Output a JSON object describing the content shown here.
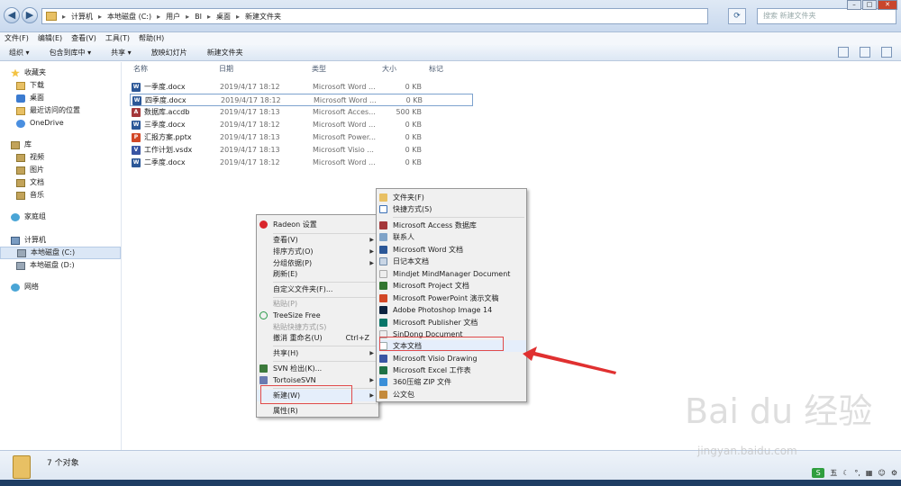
{
  "address": {
    "crumbs": [
      "计算机",
      "本地磁盘 (C:)",
      "用户",
      "BI",
      "桌面",
      "新建文件夹"
    ],
    "search_placeholder": "搜索 新建文件夹"
  },
  "menubar": [
    "文件(F)",
    "编辑(E)",
    "查看(V)",
    "工具(T)",
    "帮助(H)"
  ],
  "toolbar": [
    "组织 ▾",
    "包含到库中 ▾",
    "共享 ▾",
    "放映幻灯片",
    "新建文件夹"
  ],
  "sidebar": {
    "favorites": {
      "label": "收藏夹",
      "items": [
        "下载",
        "桌面",
        "最近访问的位置",
        "OneDrive"
      ]
    },
    "libraries": {
      "label": "库",
      "items": [
        "视频",
        "图片",
        "文档",
        "音乐"
      ]
    },
    "homegroup": "家庭组",
    "computer": {
      "label": "计算机",
      "items": [
        "本地磁盘 (C:)",
        "本地磁盘 (D:)"
      ]
    },
    "network": "网络"
  },
  "columns": {
    "name": "名称",
    "date": "日期",
    "type": "类型",
    "size": "大小",
    "tag": "标记"
  },
  "files": [
    {
      "name": "一季度.docx",
      "date": "2019/4/17 18:12",
      "type": "Microsoft Word ...",
      "size": "0 KB",
      "icon": "word-icon",
      "color": "#2b5797"
    },
    {
      "name": "四季度.docx",
      "date": "2019/4/17 18:12",
      "type": "Microsoft Word ...",
      "size": "0 KB",
      "icon": "word-icon",
      "color": "#2b5797"
    },
    {
      "name": "数据库.accdb",
      "date": "2019/4/17 18:13",
      "type": "Microsoft Acces...",
      "size": "500 KB",
      "icon": "access-icon",
      "color": "#a4373a"
    },
    {
      "name": "三季度.docx",
      "date": "2019/4/17 18:12",
      "type": "Microsoft Word ...",
      "size": "0 KB",
      "icon": "word-icon",
      "color": "#2b5797"
    },
    {
      "name": "汇报方案.pptx",
      "date": "2019/4/17 18:13",
      "type": "Microsoft Power...",
      "size": "0 KB",
      "icon": "powerpoint-icon",
      "color": "#d24726"
    },
    {
      "name": "工作计划.vsdx",
      "date": "2019/4/17 18:13",
      "type": "Microsoft Visio ...",
      "size": "0 KB",
      "icon": "visio-icon",
      "color": "#3955a3"
    },
    {
      "name": "二季度.docx",
      "date": "2019/4/17 18:12",
      "type": "Microsoft Word ...",
      "size": "0 KB",
      "icon": "word-icon",
      "color": "#2b5797"
    }
  ],
  "status": "7 个对象",
  "context_menu": {
    "radeon": "Radeon 设置",
    "view": "查看(V)",
    "sort": "排序方式(O)",
    "group": "分组依据(P)",
    "refresh": "刷新(E)",
    "customize": "自定义文件夹(F)...",
    "paste": "粘贴(P)",
    "treesize": "TreeSize Free",
    "paste_shortcut": "粘贴快捷方式(S)",
    "undo": "撤消 重命名(U)",
    "undo_shortcut": "Ctrl+Z",
    "share": "共享(H)",
    "svn_checkout": "SVN 检出(K)...",
    "tortoise": "TortoiseSVN",
    "new": "新建(W)",
    "properties": "属性(R)"
  },
  "new_submenu": {
    "folder": "文件夹(F)",
    "shortcut": "快捷方式(S)",
    "access": "Microsoft Access 数据库",
    "contact": "联系人",
    "word": "Microsoft Word 文档",
    "journal": "日记本文档",
    "mindjet": "Mindjet MindManager Document",
    "project": "Microsoft Project 文档",
    "powerpoint": "Microsoft PowerPoint 演示文稿",
    "photoshop": "Adobe Photoshop Image 14",
    "publisher": "Microsoft Publisher 文档",
    "sindong": "SinDong Document",
    "text": "文本文档",
    "visio": "Microsoft Visio Drawing",
    "excel": "Microsoft Excel 工作表",
    "zip": "360压缩 ZIP 文件",
    "briefcase": "公文包"
  },
  "watermark": {
    "main": "Bai du 经验",
    "sub": "jingyan.baidu.com"
  },
  "tray": {
    "ime": "S",
    "mode": "五"
  },
  "colors": {
    "highlight_box": "#e04a4a",
    "arrow": "#e03030"
  }
}
